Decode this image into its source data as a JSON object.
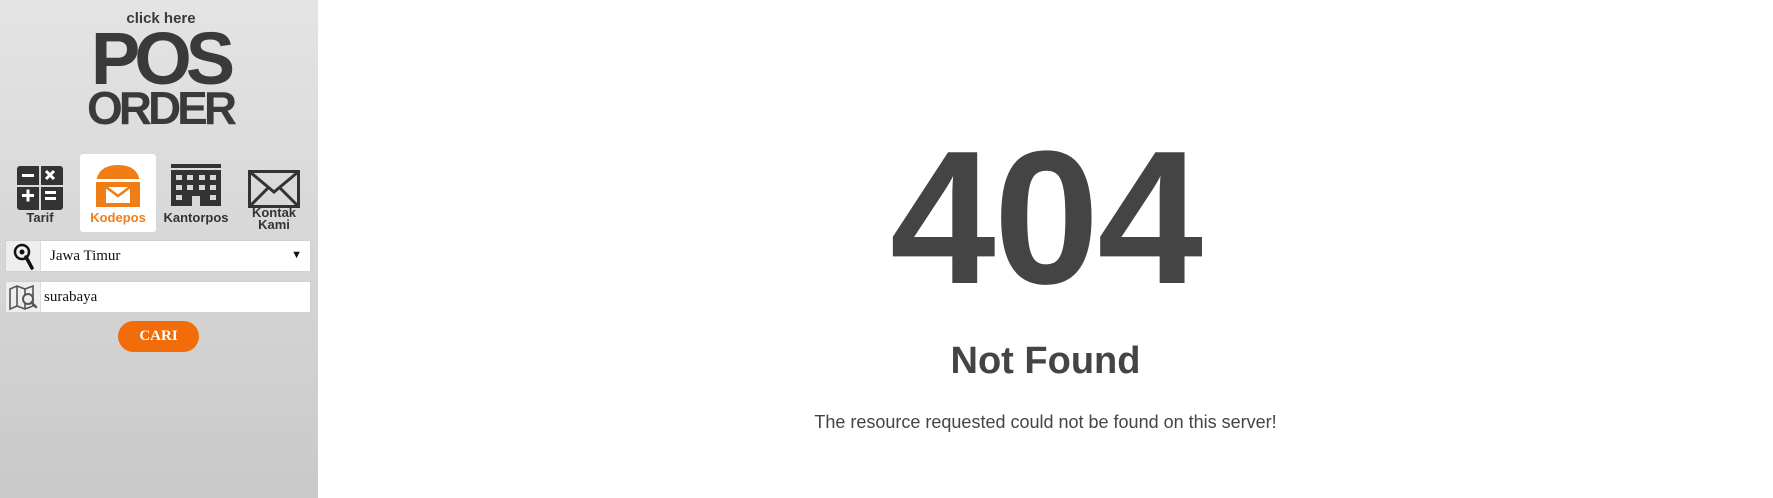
{
  "sidebar": {
    "logo": {
      "click_text": "click here",
      "line1": "POS",
      "line2": "ORDER"
    },
    "nav": [
      {
        "label": "Tarif",
        "icon": "calculator-icon"
      },
      {
        "label": "Kodepos",
        "icon": "mailbox-icon",
        "active": true
      },
      {
        "label": "Kantorpos",
        "icon": "building-icon"
      },
      {
        "label_line1": "Kontak",
        "label_line2": "Kami",
        "icon": "envelope-icon"
      }
    ],
    "province_select": {
      "value": "Jawa Timur",
      "icon": "location-search-icon"
    },
    "city_input": {
      "value": "surabaya",
      "icon": "map-search-icon"
    },
    "search_button": "CARI"
  },
  "error": {
    "code": "404",
    "title": "Not Found",
    "message": "The resource requested could not be found on this server!"
  },
  "colors": {
    "accent": "#f36c0a",
    "active_label": "#f07d16",
    "text": "#444444",
    "icon": "#333333"
  }
}
